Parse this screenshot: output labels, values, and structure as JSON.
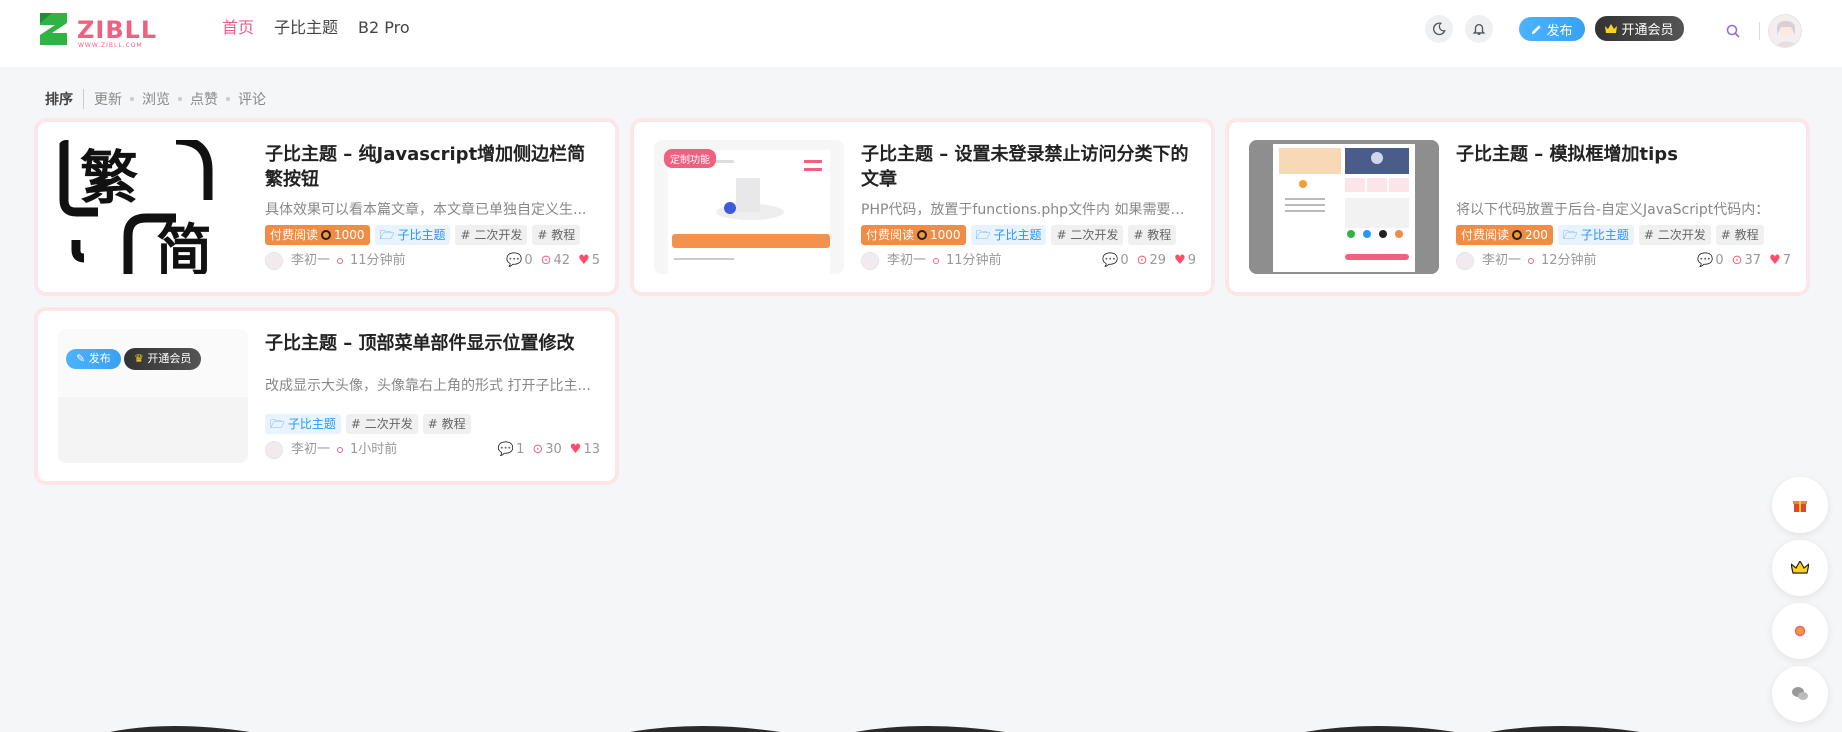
{
  "header": {
    "logo_text": "ZIBLL",
    "logo_sub": "WWW.ZIBLL.COM",
    "nav": [
      {
        "label": "首页",
        "active": true
      },
      {
        "label": "子比主题",
        "active": false
      },
      {
        "label": "B2 Pro",
        "active": false
      }
    ],
    "publish_label": "发布",
    "vip_label": "开通会员"
  },
  "sortbar": {
    "lead": "排序",
    "options": [
      "更新",
      "浏览",
      "点赞",
      "评论"
    ]
  },
  "posts": [
    {
      "title": "子比主题 – 纯Javascript增加侧边栏简繁按钮",
      "desc": "具体效果可以看本篇文章，本文章已单独自定义生...",
      "pay_label": "付费阅读",
      "price": "1000",
      "category": "子比主题",
      "tags": [
        "# 二次开发",
        "# 教程"
      ],
      "author": "李初一",
      "time": "11分钟前",
      "comments": "0",
      "views": "42",
      "likes": "5",
      "thumb_chars": [
        "繁",
        "简"
      ]
    },
    {
      "title": "子比主题 – 设置未登录禁止访问分类下的文章",
      "desc": "PHP代码，放置于functions.php文件内 如果需要增...",
      "pay_label": "付费阅读",
      "price": "1000",
      "category": "子比主题",
      "tags": [
        "# 二次开发",
        "# 教程"
      ],
      "author": "李初一",
      "time": "11分钟前",
      "comments": "0",
      "views": "29",
      "likes": "9",
      "thumb_badge": "定制功能"
    },
    {
      "title": "子比主题 – 模拟框增加tips",
      "desc": "将以下代码放置于后台-自定义JavaScript代码内：",
      "pay_label": "付费阅读",
      "price": "200",
      "category": "子比主题",
      "tags": [
        "# 二次开发",
        "# 教程"
      ],
      "author": "李初一",
      "time": "12分钟前",
      "comments": "0",
      "views": "37",
      "likes": "7"
    },
    {
      "title": "子比主题 – 顶部菜单部件显示位置修改",
      "desc": "改成显示大头像，头像靠右上角的形式 打开子比主...",
      "category": "子比主题",
      "tags": [
        "# 二次开发",
        "# 教程"
      ],
      "author": "李初一",
      "time": "1小时前",
      "comments": "1",
      "views": "30",
      "likes": "13",
      "thumb_publish": "发布",
      "thumb_vip": "开通会员"
    }
  ],
  "colors": {
    "accent": "#ed5d8c",
    "pay_tag": "#f08c45",
    "cat_tag": "#2997f7",
    "card_border": "#fde6ea"
  },
  "float_buttons": [
    "gift-icon",
    "crown-icon",
    "coin-icon",
    "wechat-icon"
  ]
}
